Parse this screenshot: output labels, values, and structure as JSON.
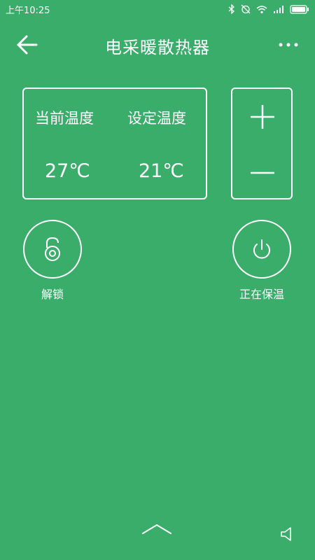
{
  "status_bar": {
    "time": "上午10:25"
  },
  "header": {
    "title": "电采暖散热器"
  },
  "temperature": {
    "current_label": "当前温度",
    "current_value": "27℃",
    "set_label": "设定温度",
    "set_value": "21℃"
  },
  "controls": {
    "lock_label": "解锁",
    "power_label": "正在保温"
  },
  "icons": {
    "back": "arrow-left-icon",
    "more": "more-dots-icon",
    "plus": "plus-icon",
    "minus": "minus-icon",
    "lock": "lock-icon",
    "power": "power-icon",
    "chevron": "chevron-up-icon",
    "volume": "speaker-icon"
  },
  "colors": {
    "background": "#3aad6b",
    "foreground": "#ffffff"
  }
}
